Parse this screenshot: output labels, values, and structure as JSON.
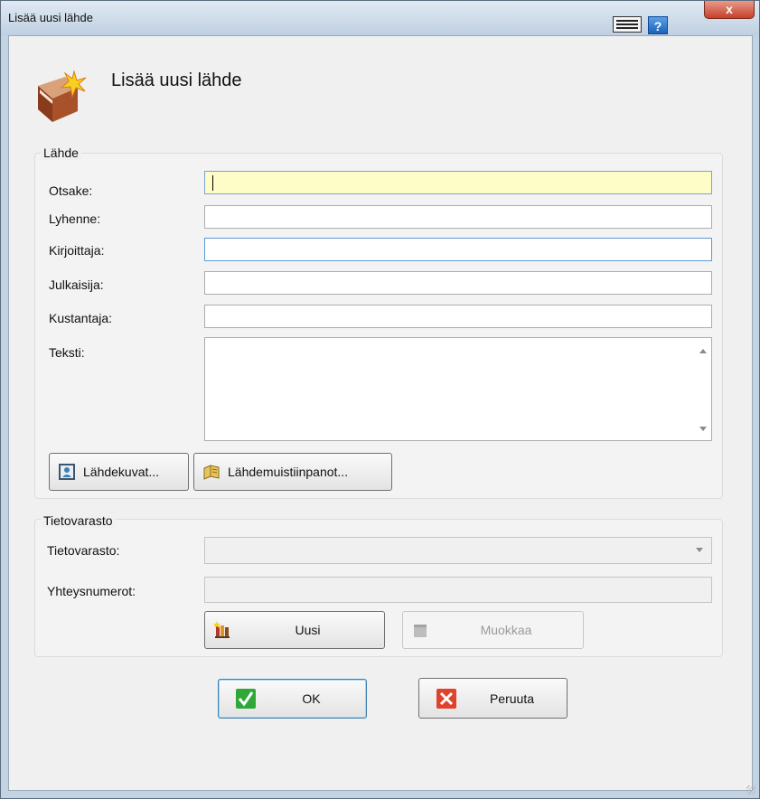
{
  "window": {
    "title": "Lisää uusi lähde",
    "help_label": "?",
    "close_label": "x"
  },
  "header": {
    "title": "Lisää uusi lähde",
    "icon": "source-book-icon"
  },
  "source_group": {
    "label": "Lähde",
    "fields": {
      "title": {
        "label": "Otsake:",
        "value": ""
      },
      "abbreviation": {
        "label": "Lyhenne:",
        "value": ""
      },
      "author": {
        "label": "Kirjoittaja:",
        "value": ""
      },
      "publisher": {
        "label": "Julkaisija:",
        "value": ""
      },
      "distributor": {
        "label": "Kustantaja:",
        "value": ""
      },
      "text": {
        "label": "Teksti:",
        "value": ""
      }
    },
    "buttons": {
      "images": "Lähdekuvat...",
      "notes": "Lähdemuistiinpanot..."
    }
  },
  "repository_group": {
    "label": "Tietovarasto",
    "fields": {
      "repository": {
        "label": "Tietovarasto:",
        "value": ""
      },
      "call_numbers": {
        "label": "Yhteysnumerot:",
        "value": ""
      }
    },
    "buttons": {
      "new": "Uusi",
      "edit": "Muokkaa"
    }
  },
  "dialog_buttons": {
    "ok": "OK",
    "cancel": "Peruuta"
  },
  "colors": {
    "focus_field": "#fffdc7",
    "ok_green": "#2fa83a",
    "cancel_red": "#e0422c"
  }
}
